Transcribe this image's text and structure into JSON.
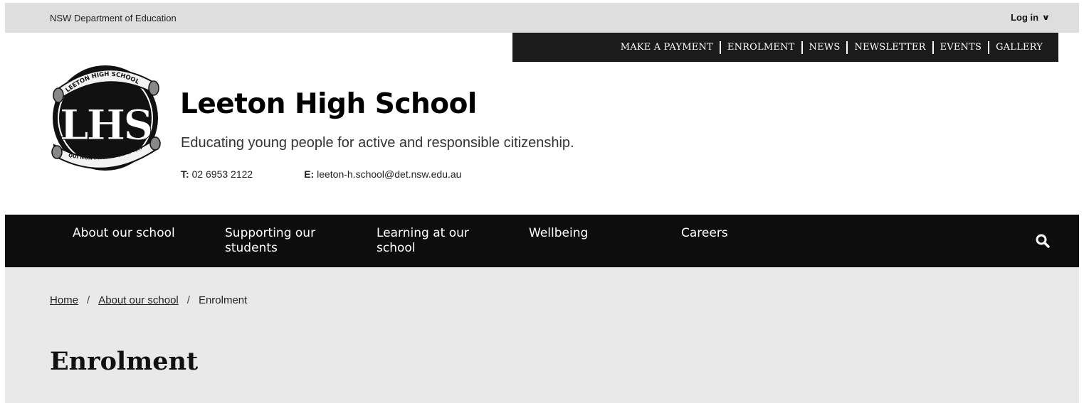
{
  "topbar": {
    "department": "NSW Department of Education",
    "login_label": "Log in",
    "login_icon": "chevron-down-icon"
  },
  "quick_links": [
    "MAKE A PAYMENT",
    "ENROLMENT",
    "NEWS",
    "NEWSLETTER",
    "EVENTS",
    "GALLERY"
  ],
  "school": {
    "logo": {
      "monogram": "LHS",
      "top_ribbon": "LEETON HIGH SCHOOL",
      "bottom_ribbon": "QUI NON PROFICIT, DEFICIT"
    },
    "name": "Leeton High School",
    "tagline": "Educating young people for active and responsible citizenship.",
    "phone_label": "T:",
    "phone": "02 6953 2122",
    "email_label": "E:",
    "email": "leeton-h.school@det.nsw.edu.au"
  },
  "main_nav": {
    "items": [
      {
        "line1": "About our school",
        "line2": ""
      },
      {
        "line1": "Supporting our",
        "line2": "students"
      },
      {
        "line1": "Learning at our",
        "line2": "school"
      },
      {
        "line1": "Wellbeing",
        "line2": ""
      },
      {
        "line1": "Careers",
        "line2": ""
      }
    ],
    "search_icon": "search-icon"
  },
  "breadcrumb": {
    "items": [
      "Home",
      "About our school",
      "Enrolment"
    ],
    "separator": "/"
  },
  "page": {
    "title": "Enrolment"
  },
  "colors": {
    "topbar_bg": "#dedede",
    "nav_bg": "#0d0d0d",
    "content_bg": "#e9e9e9",
    "text": "#111111"
  }
}
